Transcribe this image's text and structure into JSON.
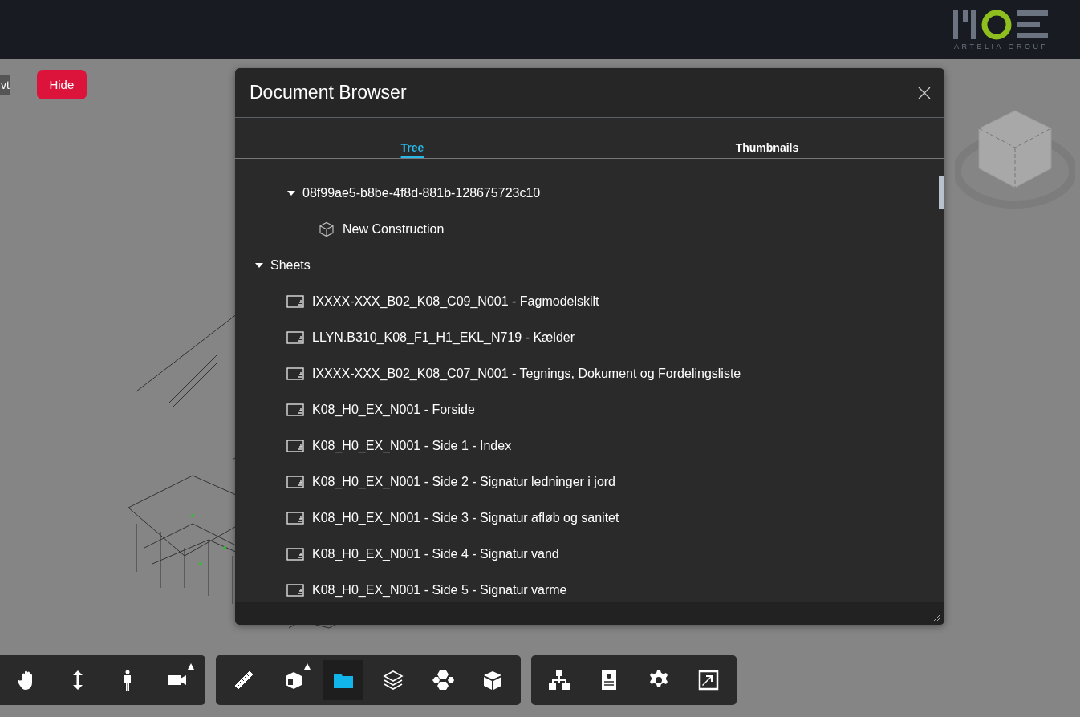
{
  "header": {
    "logo_caption": "ARTELIA GROUP"
  },
  "viewer": {
    "side_label": "vt",
    "hide_button": "Hide"
  },
  "dialog": {
    "title": "Document Browser",
    "tabs": [
      {
        "label": "Tree",
        "selected": true
      },
      {
        "label": "Thumbnails",
        "selected": false
      }
    ],
    "tree": [
      {
        "children": [
          {
            "label": "08f99ae5-b8be-4f8d-881b-128675723c10",
            "expanded": true,
            "children": [
              {
                "label": "New Construction",
                "kind": "model"
              }
            ]
          }
        ]
      },
      {
        "label": "Sheets",
        "expanded": true,
        "children": [
          {
            "label": "IXXXX-XXX_B02_K08_C09_N001 - Fagmodelskilt",
            "kind": "sheet"
          },
          {
            "label": "LLYN.B310_K08_F1_H1_EKL_N719 - Kælder",
            "kind": "sheet"
          },
          {
            "label": "IXXXX-XXX_B02_K08_C07_N001 - Tegnings, Dokument og Fordelingsliste",
            "kind": "sheet"
          },
          {
            "label": "K08_H0_EX_N001 - Forside",
            "kind": "sheet"
          },
          {
            "label": "K08_H0_EX_N001 - Side 1 - Index",
            "kind": "sheet"
          },
          {
            "label": "K08_H0_EX_N001 - Side 2 - Signatur ledninger i jord",
            "kind": "sheet"
          },
          {
            "label": "K08_H0_EX_N001 - Side 3 - Signatur afløb og sanitet",
            "kind": "sheet"
          },
          {
            "label": "K08_H0_EX_N001 - Side 4 - Signatur vand",
            "kind": "sheet"
          },
          {
            "label": "K08_H0_EX_N001 - Side 5 - Signatur varme",
            "kind": "sheet"
          }
        ]
      }
    ]
  },
  "toolbar": [
    [
      {
        "kind": "pan",
        "selected": false,
        "menu": false
      },
      {
        "kind": "zoom",
        "selected": false,
        "menu": false
      },
      {
        "kind": "walk",
        "selected": false,
        "menu": false
      },
      {
        "kind": "camera",
        "selected": false,
        "menu": true
      }
    ],
    [
      {
        "kind": "measure",
        "selected": false,
        "menu": false
      },
      {
        "kind": "section",
        "selected": false,
        "menu": true
      },
      {
        "kind": "documents",
        "selected": true,
        "menu": false
      },
      {
        "kind": "layers",
        "selected": false,
        "menu": false
      },
      {
        "kind": "explode",
        "selected": false,
        "menu": false
      },
      {
        "kind": "model",
        "selected": false,
        "menu": false
      }
    ],
    [
      {
        "kind": "structure",
        "selected": false,
        "menu": false
      },
      {
        "kind": "properties",
        "selected": false,
        "menu": false
      },
      {
        "kind": "settings",
        "selected": false,
        "menu": false
      },
      {
        "kind": "fullscreen",
        "selected": false,
        "menu": false
      }
    ]
  ]
}
